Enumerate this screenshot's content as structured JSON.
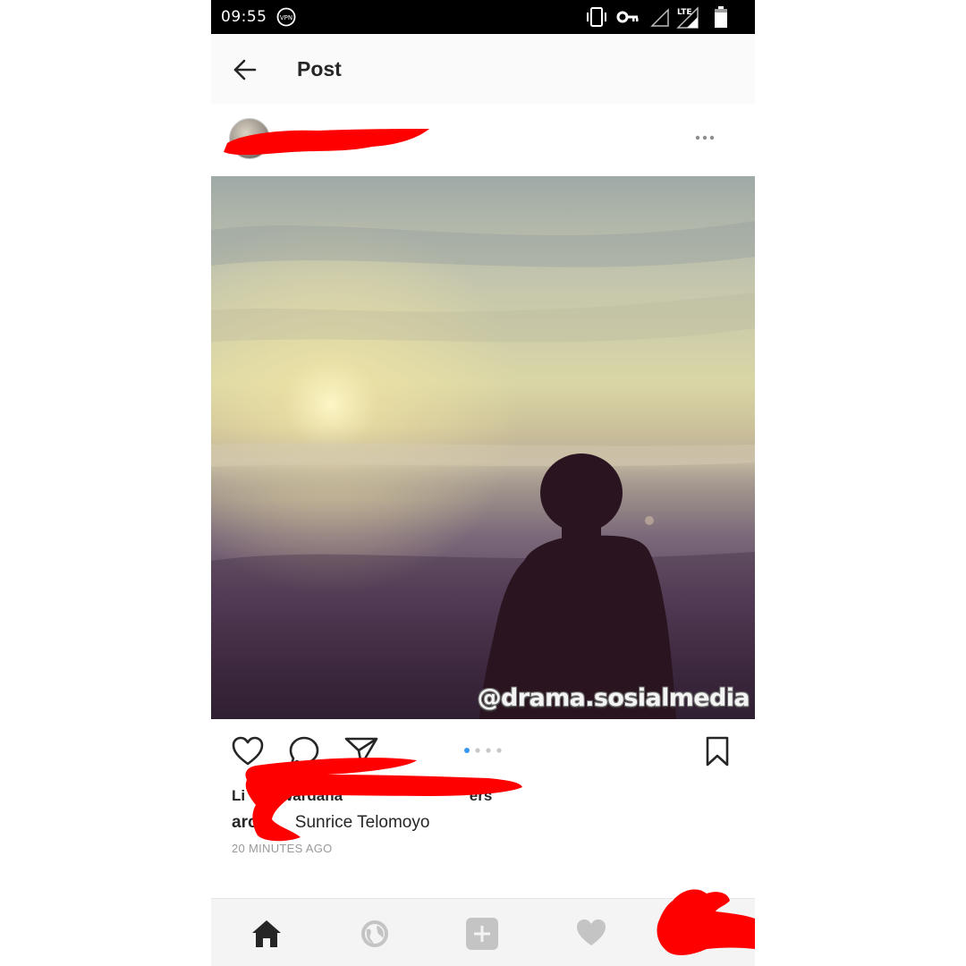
{
  "status_bar": {
    "time": "09:55",
    "vpn_icon": "vpn-key-icon",
    "vibrate_icon": "vibrate-icon",
    "key_icon": "key-icon",
    "network_label": "LTE",
    "signal_icon": "signal-icon",
    "battery_icon": "battery-icon"
  },
  "header": {
    "back_icon": "arrow-left-icon",
    "title": "Post"
  },
  "post": {
    "username": "",
    "more_icon": "more-horizontal-icon",
    "image": {
      "description_only": "",
      "watermark": "@drama.sosialmedia"
    },
    "carousel": {
      "count": 4,
      "active_index": 0,
      "active_color": "#3897f0",
      "inactive_color": "#c7c7c7"
    },
    "actions": {
      "like_icon": "heart-outline-icon",
      "comment_icon": "comment-icon",
      "share_icon": "send-icon",
      "save_icon": "bookmark-icon"
    },
    "likes_text": "Li        Wardana                              ers",
    "caption_user": "arc       ",
    "caption_text": "Sunrice Telomoyo",
    "timestamp": "20 MINUTES AGO"
  },
  "bottom_nav": {
    "items": [
      {
        "name": "home",
        "icon": "home-icon",
        "active": true
      },
      {
        "name": "explore",
        "icon": "globe-icon",
        "active": false
      },
      {
        "name": "add",
        "icon": "plus-square-icon",
        "active": false
      },
      {
        "name": "activity",
        "icon": "heart-icon",
        "active": false
      },
      {
        "name": "profile",
        "icon": "profile-icon",
        "active": false
      }
    ]
  },
  "colors": {
    "redaction": "#ff0000",
    "status_bar": "#000000",
    "text_primary": "#262626",
    "text_secondary": "#999999",
    "nav_inactive": "#bdbdbd"
  }
}
